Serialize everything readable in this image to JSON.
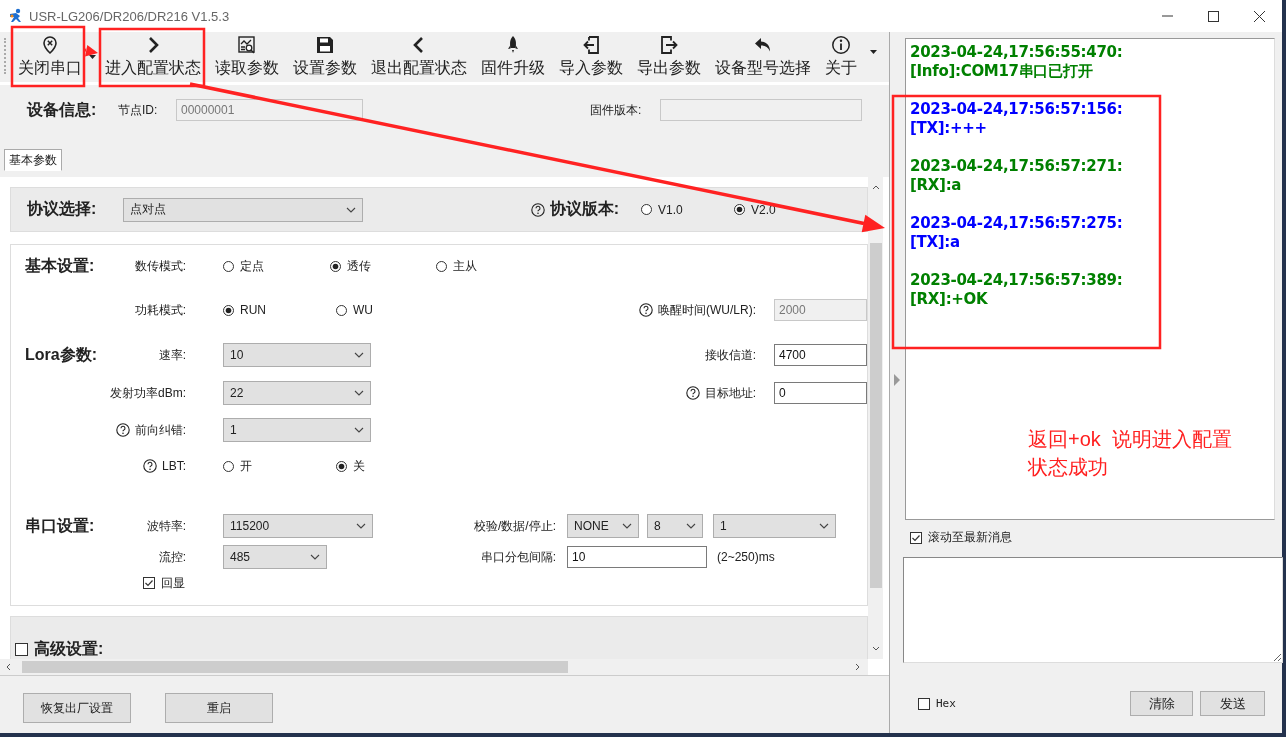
{
  "window": {
    "title": "USR-LG206/DR206/DR216 V1.5.3"
  },
  "toolbar": [
    {
      "label": "关闭串口",
      "kind": "split"
    },
    {
      "label": "进入配置状态",
      "kind": "button"
    },
    {
      "label": "读取参数",
      "kind": "button"
    },
    {
      "label": "设置参数",
      "kind": "button"
    },
    {
      "label": "退出配置状态",
      "kind": "button"
    },
    {
      "label": "固件升级",
      "kind": "button"
    },
    {
      "label": "导入参数",
      "kind": "button"
    },
    {
      "label": "导出参数",
      "kind": "button"
    },
    {
      "label": "设备型号选择",
      "kind": "button"
    },
    {
      "label": "关于",
      "kind": "button"
    }
  ],
  "device_info": {
    "heading": "设备信息:",
    "node_id_label": "节点ID:",
    "node_id": "00000001",
    "firmware_label": "固件版本:"
  },
  "tabs": [
    {
      "label": "基本参数",
      "selected": true
    }
  ],
  "protocol": {
    "label": "协议选择:",
    "value": "点对点",
    "version_label": "协议版本:",
    "versions": [
      {
        "label": "V1.0",
        "selected": false
      },
      {
        "label": "V2.0",
        "selected": true
      }
    ]
  },
  "basic": {
    "heading": "基本设置:",
    "transfer_mode": {
      "label": "数传模式:",
      "options": [
        {
          "label": "定点",
          "selected": false
        },
        {
          "label": "透传",
          "selected": true
        },
        {
          "label": "主从",
          "selected": false
        }
      ]
    },
    "power_mode": {
      "label": "功耗模式:",
      "options": [
        {
          "label": "RUN",
          "selected": true
        },
        {
          "label": "WU",
          "selected": false
        }
      ]
    },
    "wake_time": {
      "label": "唤醒时间(WU/LR):",
      "value": "2000",
      "disabled": true
    }
  },
  "lora": {
    "heading": "Lora参数:",
    "rate": {
      "label": "速率:",
      "value": "10"
    },
    "tx_power": {
      "label": "发射功率dBm:",
      "value": "22"
    },
    "fec": {
      "label": "前向纠错:",
      "value": "1"
    },
    "lbt": {
      "label": "LBT:",
      "options": [
        {
          "label": "开",
          "selected": false
        },
        {
          "label": "关",
          "selected": true
        }
      ]
    },
    "rx_channel": {
      "label": "接收信道:",
      "value": "4700"
    },
    "target_address": {
      "label": "目标地址:",
      "value": "0"
    }
  },
  "serial": {
    "heading": "串口设置:",
    "baud": {
      "label": "波特率:",
      "value": "115200"
    },
    "flow": {
      "label": "流控:",
      "value": "485"
    },
    "echo": {
      "label": "回显",
      "checked": true
    },
    "frame": {
      "label": "校验/数据/停止:",
      "parity": "NONE",
      "data_bits": "8",
      "stop_bits": "1"
    },
    "packet_interval": {
      "label": "串口分包间隔:",
      "value": "10",
      "unit": "(2~250)ms"
    }
  },
  "advanced": {
    "label": "高级设置:",
    "checked": false
  },
  "bottom_buttons": [
    "恢复出厂设置",
    "重启"
  ],
  "log": {
    "entries": [
      {
        "kind": "info",
        "time": "2023-04-24,17:56:55:470:",
        "text": "[Info]:COM17串口已打开"
      },
      {
        "kind": "tx",
        "time": "2023-04-24,17:56:57:156:",
        "text": "[TX]:+++"
      },
      {
        "kind": "rx",
        "time": "2023-04-24,17:56:57:271:",
        "text": "[RX]:a"
      },
      {
        "kind": "tx",
        "time": "2023-04-24,17:56:57:275:",
        "text": "[TX]:a"
      },
      {
        "kind": "rx",
        "time": "2023-04-24,17:56:57:389:",
        "text": "[RX]:+OK"
      }
    ]
  },
  "auto_scroll": {
    "label": "滚动至最新消息",
    "checked": true
  },
  "hex": {
    "label": "Hex",
    "checked": false
  },
  "send_buttons": [
    "清除",
    "发送"
  ],
  "annotation": {
    "note": "返回+ok  说明进入配置状态成功"
  }
}
